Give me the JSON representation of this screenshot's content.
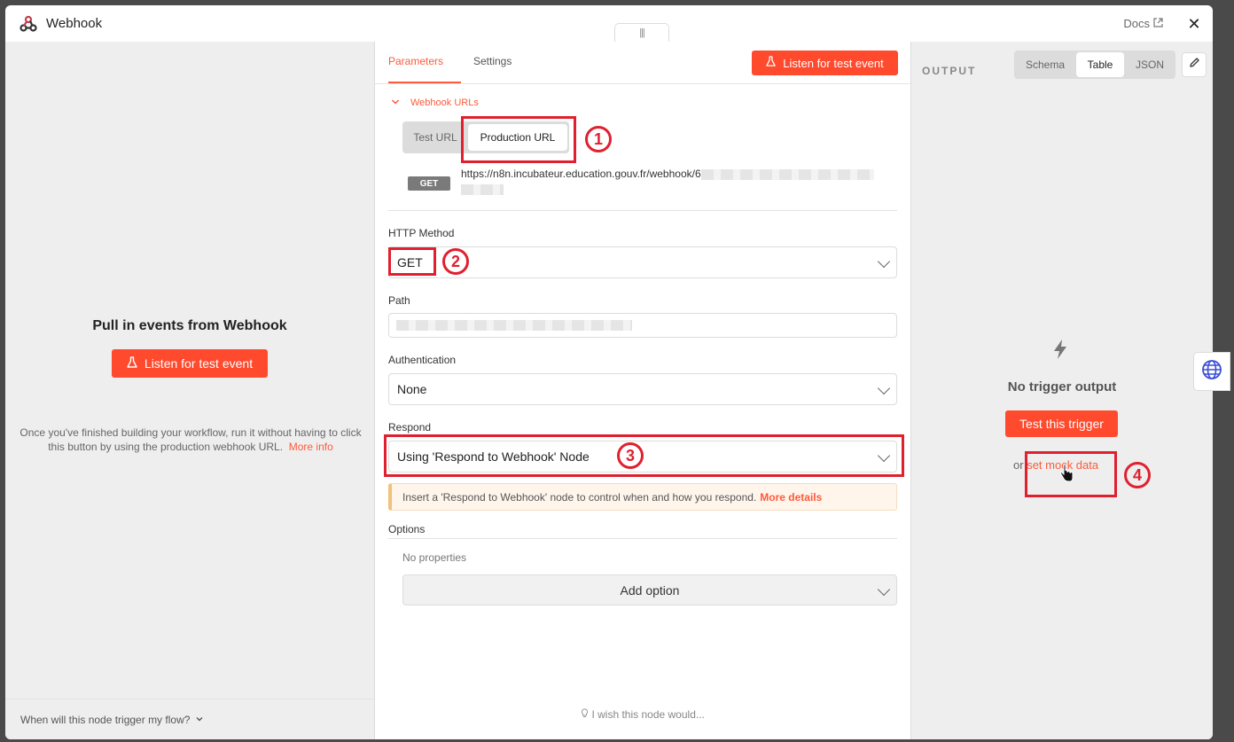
{
  "header": {
    "title": "Webhook",
    "docs_label": "Docs",
    "drag_handle": "|||",
    "close_label": "✕"
  },
  "left": {
    "title": "Pull in events from Webhook",
    "listen_label": "Listen for test event",
    "description": "Once you've finished building your workflow, run it without having to click this button by using the production webhook URL.",
    "more_info": "More info",
    "footer_question": "When will this node trigger my flow?"
  },
  "center": {
    "tabs": [
      {
        "label": "Parameters",
        "active": true
      },
      {
        "label": "Settings",
        "active": false
      }
    ],
    "listen_label": "Listen for test event",
    "webhook_urls": {
      "label": "Webhook URLs",
      "test_url_label": "Test URL",
      "production_url_label": "Production URL",
      "method_badge": "GET",
      "url_prefix": "https://n8n.incubateur.education.gouv.fr/webhook/6"
    },
    "http_method": {
      "label": "HTTP Method",
      "value": "GET"
    },
    "path": {
      "label": "Path",
      "value": ""
    },
    "authentication": {
      "label": "Authentication",
      "value": "None"
    },
    "respond": {
      "label": "Respond",
      "value": "Using 'Respond to Webhook' Node"
    },
    "notice": {
      "text": "Insert a 'Respond to Webhook' node to control when and how you respond.",
      "link": "More details"
    },
    "options": {
      "label": "Options",
      "empty": "No properties",
      "add_label": "Add option"
    },
    "wish": "I wish this node would..."
  },
  "right": {
    "output_label": "OUTPUT",
    "views": [
      {
        "label": "Schema",
        "active": false
      },
      {
        "label": "Table",
        "active": true
      },
      {
        "label": "JSON",
        "active": false
      }
    ],
    "empty_title": "No trigger output",
    "test_trigger_label": "Test this trigger",
    "or_label": "or",
    "mock_link": "set mock data"
  },
  "annotations": {
    "n1": "1",
    "n2": "2",
    "n3": "3",
    "n4": "4"
  },
  "colors": {
    "accent": "#ff4a2e",
    "annotation": "#e0202f"
  }
}
